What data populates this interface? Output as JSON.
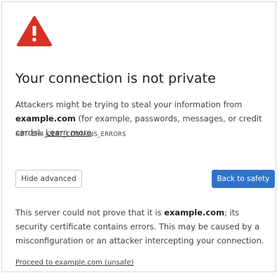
{
  "icon": "warning-triangle-icon",
  "colors": {
    "warning_red": "#d93025",
    "primary_button": "#2f73c9",
    "text": "#3c4043"
  },
  "main": {
    "title": "Your connection is not private",
    "description_prefix": "Attackers might be trying to steal your information from ",
    "description_domain": "example.com",
    "description_suffix": " (for example, passwords, messages, or credit cards). ",
    "learn_more_label": "Learn more",
    "error_code": "NET::ERR_CERT_CONTAINS_ERRORS"
  },
  "buttons": {
    "hide_advanced_label": "Hide advanced",
    "back_to_safety_label": "Back to safety"
  },
  "advanced": {
    "text_prefix": "This server could not prove that it is ",
    "domain": "example.com",
    "text_suffix": "; its security certificate contains errors. This may be caused by a misconfiguration or an attacker intercepting your connection.",
    "proceed_label": "Proceed to example.com (unsafe)"
  }
}
